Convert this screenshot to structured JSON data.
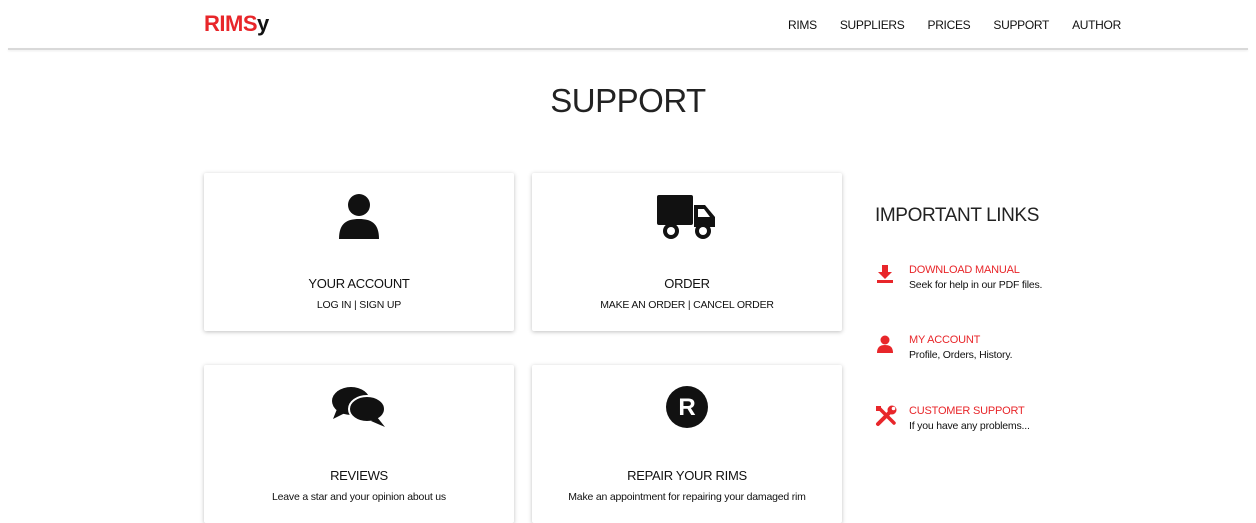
{
  "brand": {
    "main": "RIMS",
    "tail": "y",
    "accent": "#e8262a"
  },
  "nav": {
    "items": [
      "RIMS",
      "SUPPLIERS",
      "PRICES",
      "SUPPORT",
      "AUTHOR"
    ]
  },
  "page": {
    "title": "SUPPORT"
  },
  "cards": [
    {
      "icon": "user-icon",
      "title": "YOUR ACCOUNT",
      "subtitle": "LOG IN | SIGN UP"
    },
    {
      "icon": "truck-icon",
      "title": "ORDER",
      "subtitle": "MAKE AN ORDER | CANCEL ORDER"
    },
    {
      "icon": "comments-icon",
      "title": "REVIEWS",
      "subtitle": "Leave a star and your opinion about us"
    },
    {
      "icon": "registered-icon",
      "title": "REPAIR YOUR RIMS",
      "subtitle": "Make an appointment for repairing your damaged rim"
    }
  ],
  "important_links": {
    "title": "IMPORTANT LINKS",
    "items": [
      {
        "icon": "download-icon",
        "label": "DOWNLOAD MANUAL",
        "description": "Seek for help in our PDF files."
      },
      {
        "icon": "user-icon",
        "label": "MY ACCOUNT",
        "description": "Profile, Orders, History."
      },
      {
        "icon": "tools-icon",
        "label": "CUSTOMER SUPPORT",
        "description": "If you have any problems..."
      }
    ]
  }
}
